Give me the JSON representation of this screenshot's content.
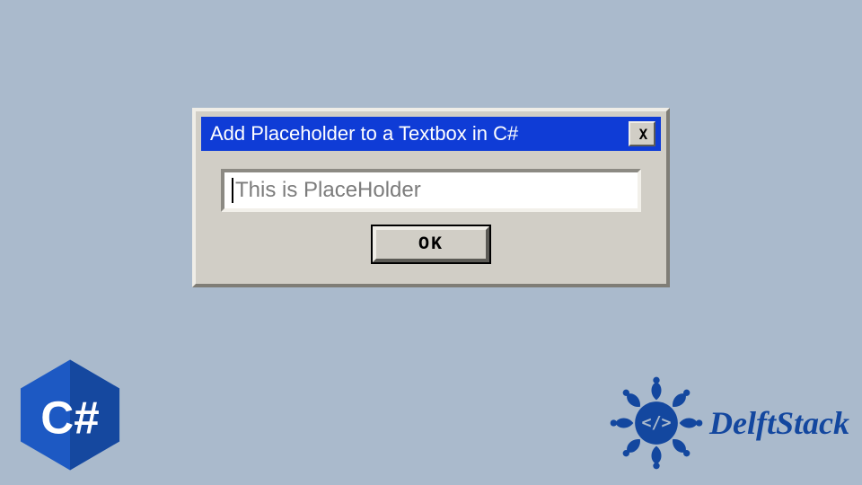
{
  "dialog": {
    "title": "Add Placeholder to a Textbox in C#",
    "close_icon": "X",
    "textbox": {
      "value": "",
      "placeholder": "This is PlaceHolder"
    },
    "ok_label": "OK"
  },
  "badges": {
    "csharp_label": "C#",
    "delftstack_label": "DelftStack"
  },
  "colors": {
    "page_bg": "#aabacc",
    "titlebar_bg": "#0f3cd6",
    "dialog_body": "#d1cec6",
    "csharp_hex_bg": "#1d59c3",
    "delft_brand": "#13479f"
  }
}
